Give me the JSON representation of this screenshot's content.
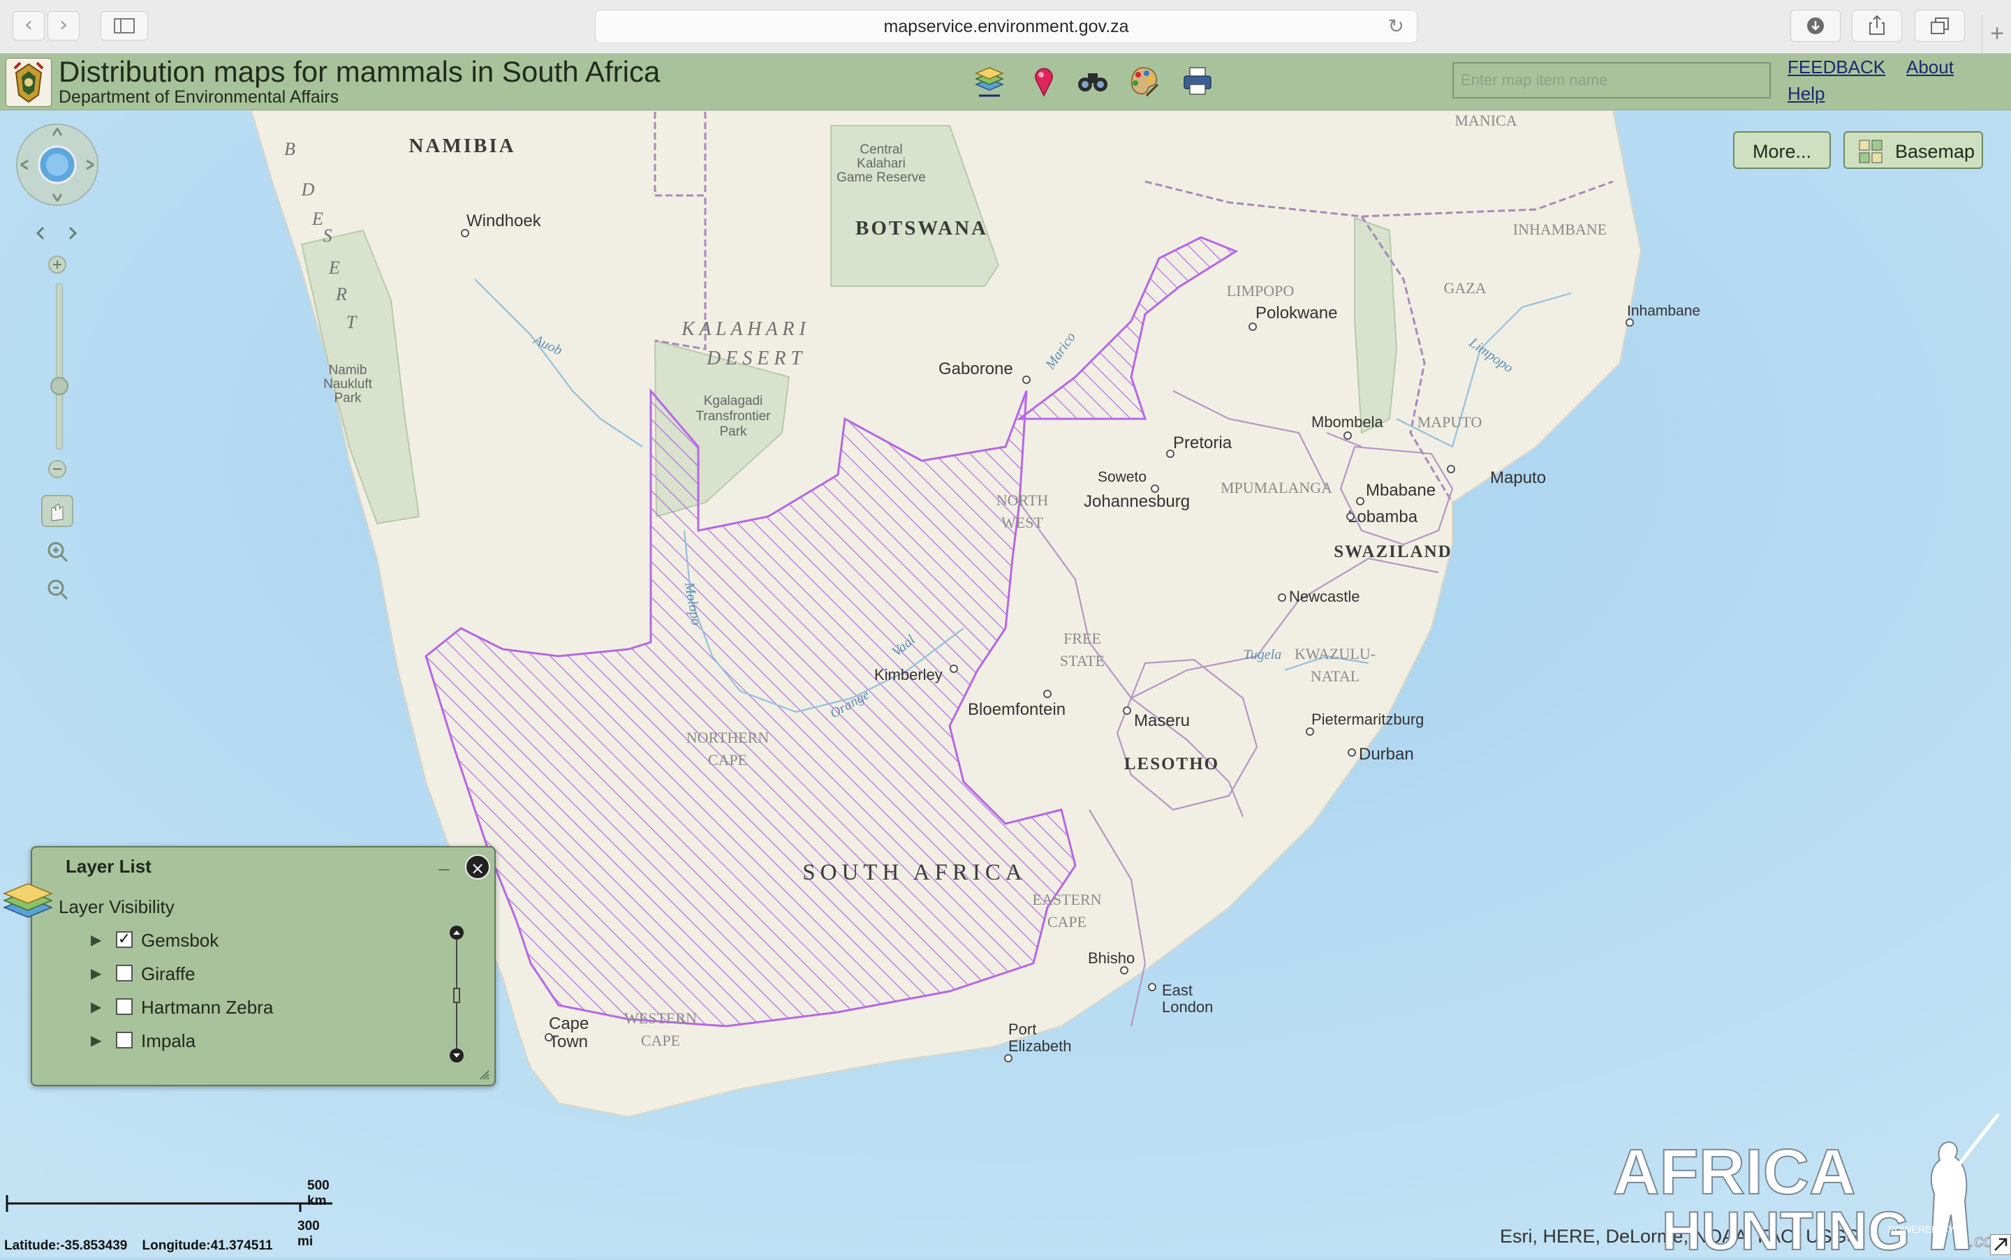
{
  "browser": {
    "url": "mapservice.environment.gov.za",
    "back_icon": "chevron-left-icon",
    "forward_icon": "chevron-right-icon",
    "sidebar_icon": "sidebar-icon",
    "reload_icon": "reload-icon",
    "download_icon": "download-icon",
    "share_icon": "share-icon",
    "tabs_icon": "tabs-icon",
    "newtab_symbol": "+"
  },
  "header": {
    "title": "Distribution maps for mammals in South Africa",
    "subtitle": "Department of Environmental Affairs",
    "search_placeholder": "Enter map item name",
    "links": {
      "feedback": "FEEDBACK",
      "about": "About",
      "help": "Help"
    },
    "tools": [
      "layers-icon",
      "location-pin-icon",
      "binoculars-icon",
      "palette-icon",
      "print-icon"
    ],
    "colors": {
      "header_bg": "#a8c29c",
      "link": "#1a2a6e"
    }
  },
  "map_buttons": {
    "more": "More...",
    "basemap": "Basemap"
  },
  "map_labels": {
    "namibia": "NAMIBIA",
    "windhoek": "Windhoek",
    "desert": [
      "B",
      "D",
      "E",
      "S",
      "E",
      "R",
      "T"
    ],
    "namib_park": [
      "Namib",
      "Naukluft",
      "Park"
    ],
    "central_kalahari": [
      "Central",
      "Kalahari",
      "Game Reserve"
    ],
    "botswana": "BOTSWANA",
    "kalahari_desert": [
      "K A L A H A R I",
      "D E S E R T"
    ],
    "kgalagadi": [
      "Kgalagadi",
      "Transfrontier",
      "Park"
    ],
    "gaborone": "Gaborone",
    "auob": "Auob",
    "marico": "Marico",
    "molopo": "Molopo",
    "orange": "Orange",
    "vaal": "Vaal",
    "limpopo_prov": "LIMPOPO",
    "polokwane": "Polokwane",
    "manica": "MANICA",
    "inhambane_prov": "INHAMBANE",
    "gaza": "GAZA",
    "inhambane": "Inhambane",
    "limpopo_river": "Limpopo",
    "mbombela": "Mbombela",
    "maputo_prov": "MAPUTO",
    "pretoria": "Pretoria",
    "maputo": "Maputo",
    "soweto": "Soweto",
    "johannesburg": "Johannesburg",
    "mpumalanga": "MPUMALANGA",
    "mbabane": "Mbabane",
    "lobamba": "Lobamba",
    "swaziland": "SWAZILAND",
    "north_west": [
      "NORTH",
      "WEST"
    ],
    "newcastle": "Newcastle",
    "free_state": [
      "FREE",
      "STATE"
    ],
    "tugela": "Tugela",
    "kwazulu": [
      "KWAZULU-",
      "NATAL"
    ],
    "kimberley": "Kimberley",
    "bloemfontein": "Bloemfontein",
    "maseru": "Maseru",
    "pietermaritzburg": "Pietermaritzburg",
    "northern_cape": [
      "NORTHERN",
      "CAPE"
    ],
    "lesotho": "LESOTHO",
    "durban": "Durban",
    "south_africa": "SOUTH AFRICA",
    "eastern_cape": [
      "EASTERN",
      "CAPE"
    ],
    "bhisho": "Bhisho",
    "east_london": [
      "East",
      "London"
    ],
    "cape_town": [
      "Cape",
      "Town"
    ],
    "western_cape": [
      "WESTERN",
      "CAPE"
    ],
    "port_elizabeth": [
      "Port",
      "Elizabeth"
    ]
  },
  "layer_list": {
    "title": "Layer List",
    "minimize": "_",
    "close": "×",
    "visibility_label": "Layer Visibility",
    "items": [
      {
        "label": "Gemsbok",
        "checked": true,
        "check": "✓"
      },
      {
        "label": "Giraffe",
        "checked": false,
        "check": ""
      },
      {
        "label": "Hartmann Zebra",
        "checked": false,
        "check": ""
      },
      {
        "label": "Impala",
        "checked": false,
        "check": ""
      }
    ],
    "expander": "▶"
  },
  "scale": {
    "km": "500 km",
    "mi": "300 mi"
  },
  "coords": {
    "lat_label": "Latitude:",
    "lat": "-35.853439",
    "lon_label": "Longitude:",
    "lon": "41.374511"
  },
  "attribution": "Esri, HERE, DeLorme, NOAA, FAO, USGS",
  "watermark": {
    "line1": "AFRICA",
    "line2": "HUNTING",
    "small": "POWERED BY",
    "dotcom": ".com"
  },
  "colors": {
    "ocean": "#b9dcf0",
    "land": "#f1efe4",
    "park": "#d8e2cc",
    "distribution": "#b667e6",
    "border": "#a78ab8"
  }
}
